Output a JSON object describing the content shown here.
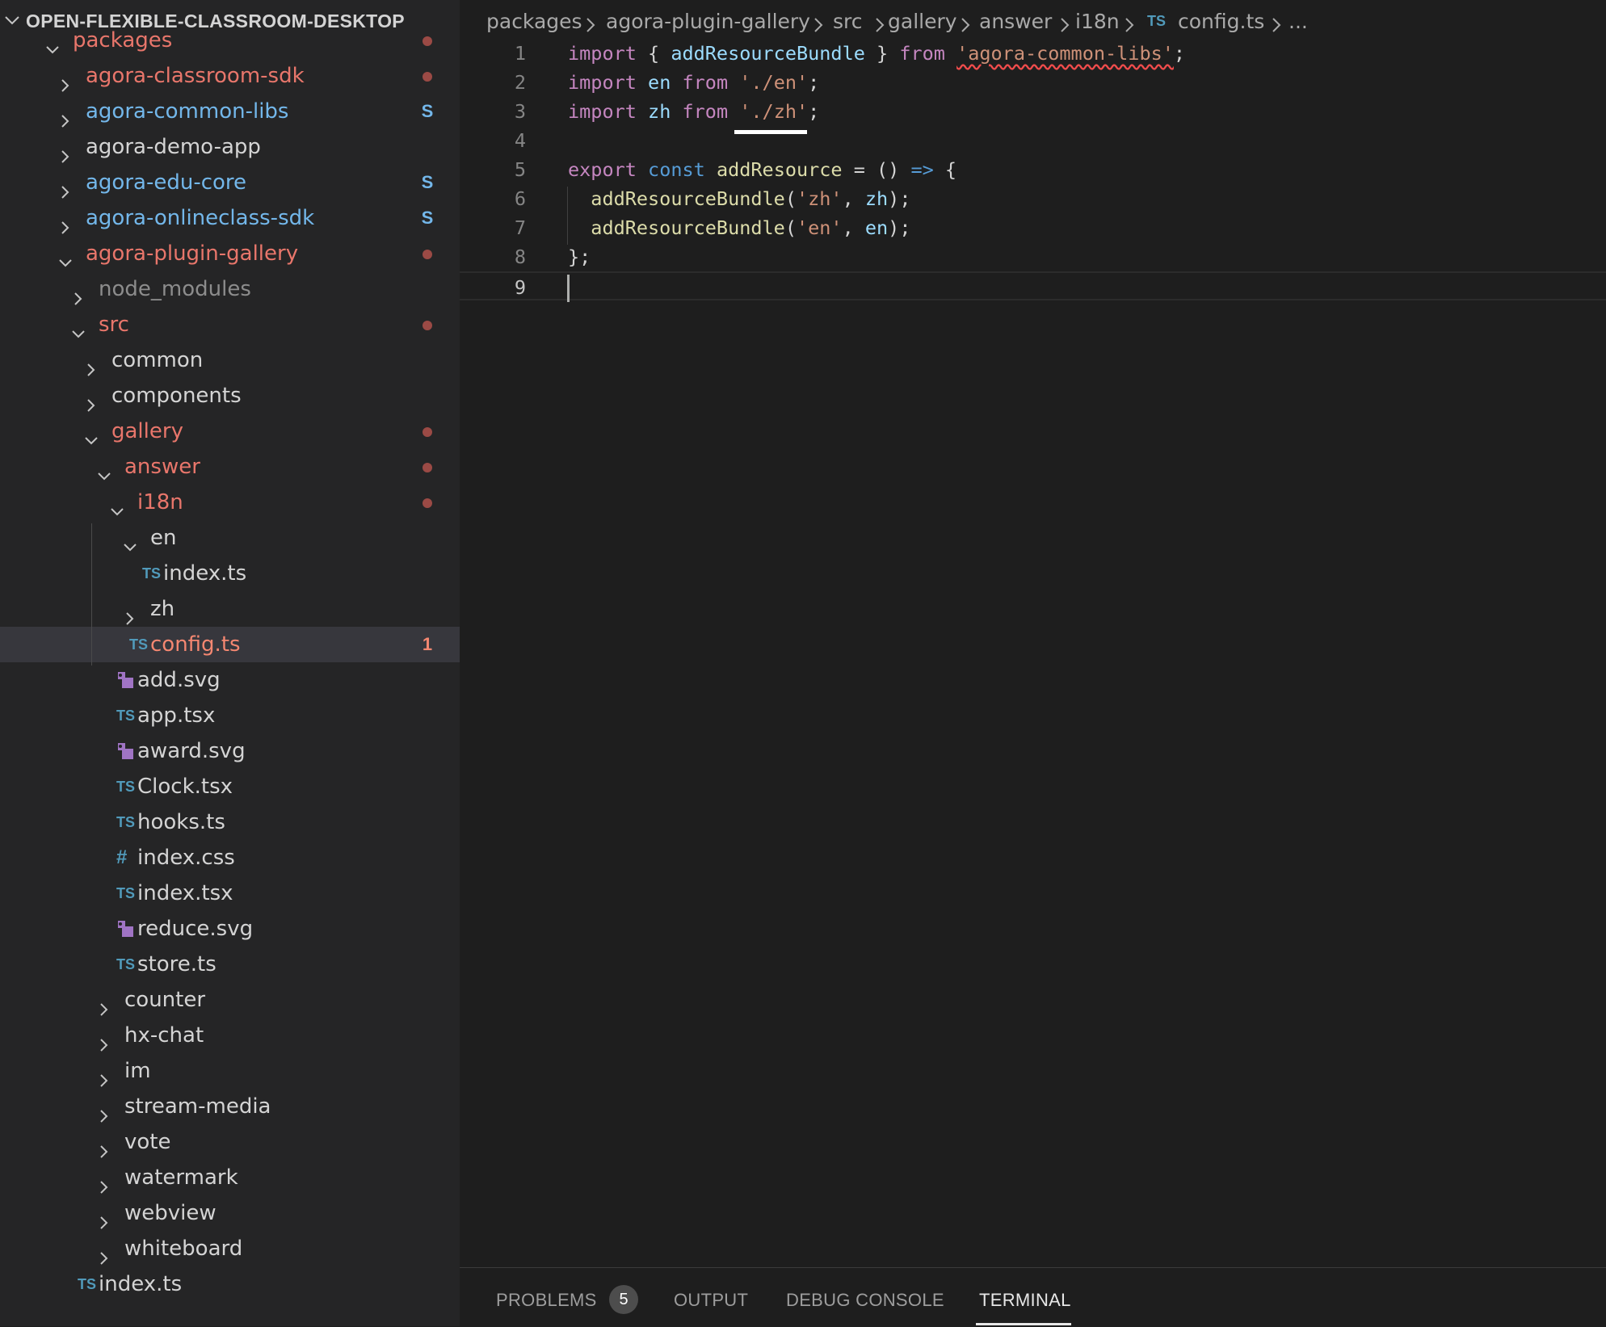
{
  "explorer": {
    "title": "OPEN-FLEXIBLE-CLASSROOM-DESKTOP",
    "tree": [
      {
        "label": "packages",
        "kind": "folder",
        "expanded": true,
        "status": "modified",
        "decoration": "dot"
      },
      {
        "label": "agora-classroom-sdk",
        "kind": "folder",
        "expanded": false,
        "status": "modified",
        "decoration": "dot"
      },
      {
        "label": "agora-common-libs",
        "kind": "folder",
        "expanded": false,
        "status": "staged",
        "decoration": "S"
      },
      {
        "label": "agora-demo-app",
        "kind": "folder",
        "expanded": false,
        "status": "normal",
        "decoration": ""
      },
      {
        "label": "agora-edu-core",
        "kind": "folder",
        "expanded": false,
        "status": "staged",
        "decoration": "S"
      },
      {
        "label": "agora-onlineclass-sdk",
        "kind": "folder",
        "expanded": false,
        "status": "staged",
        "decoration": "S"
      },
      {
        "label": "agora-plugin-gallery",
        "kind": "folder",
        "expanded": true,
        "status": "modified",
        "decoration": "dot"
      },
      {
        "label": "node_modules",
        "kind": "folder",
        "expanded": false,
        "status": "ignored",
        "decoration": ""
      },
      {
        "label": "src",
        "kind": "folder",
        "expanded": true,
        "status": "modified",
        "decoration": "dot"
      },
      {
        "label": "common",
        "kind": "folder",
        "expanded": false,
        "status": "normal",
        "decoration": ""
      },
      {
        "label": "components",
        "kind": "folder",
        "expanded": false,
        "status": "normal",
        "decoration": ""
      },
      {
        "label": "gallery",
        "kind": "folder",
        "expanded": true,
        "status": "modified",
        "decoration": "dot"
      },
      {
        "label": "answer",
        "kind": "folder",
        "expanded": true,
        "status": "modified",
        "decoration": "dot"
      },
      {
        "label": "i18n",
        "kind": "folder",
        "expanded": true,
        "status": "modified",
        "decoration": "dot"
      },
      {
        "label": "en",
        "kind": "folder",
        "expanded": true,
        "status": "normal",
        "decoration": ""
      },
      {
        "label": "index.ts",
        "kind": "ts",
        "status": "normal",
        "decoration": ""
      },
      {
        "label": "zh",
        "kind": "folder",
        "expanded": false,
        "status": "normal",
        "decoration": ""
      },
      {
        "label": "config.ts",
        "kind": "ts",
        "status": "error",
        "decoration": "1",
        "selected": true
      },
      {
        "label": "add.svg",
        "kind": "svg",
        "status": "normal",
        "decoration": ""
      },
      {
        "label": "app.tsx",
        "kind": "ts",
        "status": "normal",
        "decoration": ""
      },
      {
        "label": "award.svg",
        "kind": "svg",
        "status": "normal",
        "decoration": ""
      },
      {
        "label": "Clock.tsx",
        "kind": "ts",
        "status": "normal",
        "decoration": ""
      },
      {
        "label": "hooks.ts",
        "kind": "ts",
        "status": "normal",
        "decoration": ""
      },
      {
        "label": "index.css",
        "kind": "css",
        "status": "normal",
        "decoration": ""
      },
      {
        "label": "index.tsx",
        "kind": "ts",
        "status": "normal",
        "decoration": ""
      },
      {
        "label": "reduce.svg",
        "kind": "svg",
        "status": "normal",
        "decoration": ""
      },
      {
        "label": "store.ts",
        "kind": "ts",
        "status": "normal",
        "decoration": ""
      },
      {
        "label": "counter",
        "kind": "folder",
        "expanded": false,
        "status": "normal",
        "decoration": ""
      },
      {
        "label": "hx-chat",
        "kind": "folder",
        "expanded": false,
        "status": "normal",
        "decoration": ""
      },
      {
        "label": "im",
        "kind": "folder",
        "expanded": false,
        "status": "normal",
        "decoration": ""
      },
      {
        "label": "stream-media",
        "kind": "folder",
        "expanded": false,
        "status": "normal",
        "decoration": ""
      },
      {
        "label": "vote",
        "kind": "folder",
        "expanded": false,
        "status": "normal",
        "decoration": ""
      },
      {
        "label": "watermark",
        "kind": "folder",
        "expanded": false,
        "status": "normal",
        "decoration": ""
      },
      {
        "label": "webview",
        "kind": "folder",
        "expanded": false,
        "status": "normal",
        "decoration": ""
      },
      {
        "label": "whiteboard",
        "kind": "folder",
        "expanded": false,
        "status": "normal",
        "decoration": ""
      },
      {
        "label": "index.ts",
        "kind": "ts",
        "status": "normal",
        "decoration": ""
      }
    ],
    "icons": {
      "ts": "TS",
      "css": "#",
      "svg": "svg-image-icon"
    }
  },
  "breadcrumb": {
    "items": [
      "packages",
      "agora-plugin-gallery",
      "src",
      "gallery",
      "answer",
      "i18n",
      "config.ts",
      "..."
    ],
    "file_icon": "TS"
  },
  "editor": {
    "current_line": 9,
    "lines": [
      {
        "n": "1",
        "tokens": [
          [
            "kw",
            "import"
          ],
          [
            "p",
            " { "
          ],
          [
            "var",
            "addResourceBundle"
          ],
          [
            "p",
            " } "
          ],
          [
            "kw",
            "from"
          ],
          [
            "p",
            " "
          ],
          [
            "str squiggle",
            "'agora-common-libs'"
          ],
          [
            "p",
            ";"
          ]
        ]
      },
      {
        "n": "2",
        "tokens": [
          [
            "kw",
            "import"
          ],
          [
            "p",
            " "
          ],
          [
            "var",
            "en"
          ],
          [
            "p",
            " "
          ],
          [
            "kw",
            "from"
          ],
          [
            "p",
            " "
          ],
          [
            "str",
            "'./en'"
          ],
          [
            "p",
            ";"
          ]
        ]
      },
      {
        "n": "3",
        "tokens": [
          [
            "kw",
            "import"
          ],
          [
            "p",
            " "
          ],
          [
            "var",
            "zh"
          ],
          [
            "p",
            " "
          ],
          [
            "kw",
            "from"
          ],
          [
            "p",
            " "
          ],
          [
            "str",
            "'./zh'"
          ],
          [
            "p",
            ";"
          ]
        ]
      },
      {
        "n": "4",
        "tokens": []
      },
      {
        "n": "5",
        "tokens": [
          [
            "kw",
            "export"
          ],
          [
            "p",
            " "
          ],
          [
            "kb",
            "const"
          ],
          [
            "p",
            " "
          ],
          [
            "fn",
            "addResource"
          ],
          [
            "p",
            " = () "
          ],
          [
            "kb",
            "=>"
          ],
          [
            "p",
            " {"
          ]
        ]
      },
      {
        "n": "6",
        "tokens": [
          [
            "p",
            "  "
          ],
          [
            "fn",
            "addResourceBundle"
          ],
          [
            "p",
            "("
          ],
          [
            "str",
            "'zh'"
          ],
          [
            "p",
            ", "
          ],
          [
            "var",
            "zh"
          ],
          [
            "p",
            ");"
          ]
        ]
      },
      {
        "n": "7",
        "tokens": [
          [
            "p",
            "  "
          ],
          [
            "fn",
            "addResourceBundle"
          ],
          [
            "p",
            "("
          ],
          [
            "str",
            "'en'"
          ],
          [
            "p",
            ", "
          ],
          [
            "var",
            "en"
          ],
          [
            "p",
            ");"
          ]
        ]
      },
      {
        "n": "8",
        "tokens": [
          [
            "p",
            "};"
          ]
        ]
      },
      {
        "n": "9",
        "tokens": []
      }
    ]
  },
  "panel": {
    "tabs": [
      "PROBLEMS",
      "OUTPUT",
      "DEBUG CONSOLE",
      "TERMINAL"
    ],
    "active_tab": "TERMINAL",
    "problems_count": "5"
  },
  "colors": {
    "modified": "#e8766b",
    "staged": "#73b7ea",
    "error": "#f48771",
    "dot": "#9b4a45",
    "keyword": "#c586c0",
    "keyword_blue": "#569cd6",
    "variable": "#9cdcfe",
    "function": "#dcdcaa",
    "string": "#ce9178"
  }
}
